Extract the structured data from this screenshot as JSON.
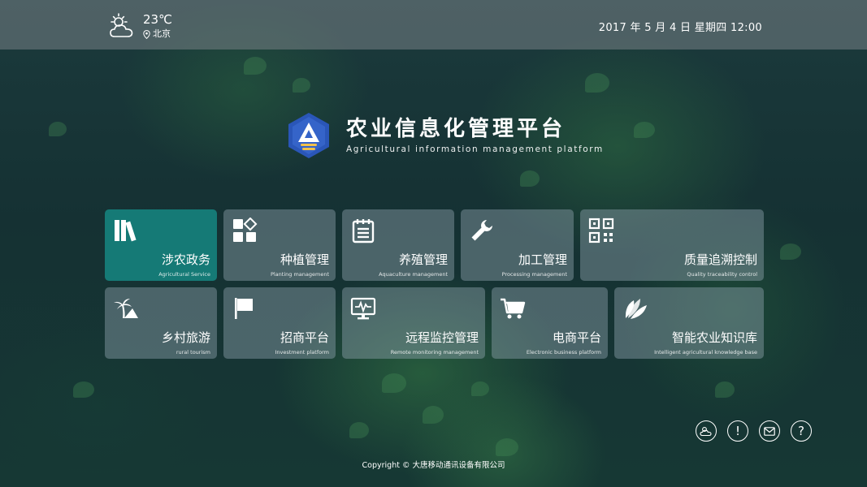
{
  "weather": {
    "temperature": "23℃",
    "city": "北京",
    "icon": "partly-cloudy-icon"
  },
  "datetime": "2017 年 5 月 4 日  星期四  12:00",
  "brand": {
    "title": "农业信息化管理平台",
    "subtitle": "Agricultural information management platform",
    "logo_icon": "platform-logo-icon"
  },
  "tiles": [
    {
      "label": "涉农政务",
      "sub": "Agricultural Service",
      "icon": "books-icon",
      "active": true
    },
    {
      "label": "种植管理",
      "sub": "Planting management",
      "icon": "grid-apps-icon"
    },
    {
      "label": "养殖管理",
      "sub": "Aquaculture management",
      "icon": "notepad-icon"
    },
    {
      "label": "加工管理",
      "sub": "Processing management",
      "icon": "wrench-icon"
    },
    {
      "label": "质量追溯控制",
      "sub": "Quality traceability control",
      "icon": "qr-code-icon"
    },
    {
      "label": "乡村旅游",
      "sub": "rural tourism",
      "icon": "palm-tree-icon"
    },
    {
      "label": "招商平台",
      "sub": "Investment platform",
      "icon": "flag-icon"
    },
    {
      "label": "远程监控管理",
      "sub": "Remote monitoring management",
      "icon": "monitor-icon"
    },
    {
      "label": "电商平台",
      "sub": "Electronic business platform",
      "icon": "shopping-cart-icon"
    },
    {
      "label": "智能农业知识库",
      "sub": "Intelligent agricultural knowledge base",
      "icon": "leaf-icon"
    }
  ],
  "tools": [
    {
      "icon": "weather-icon",
      "glyph": ""
    },
    {
      "icon": "alert-icon",
      "glyph": "!"
    },
    {
      "icon": "mail-icon",
      "glyph": ""
    },
    {
      "icon": "help-icon",
      "glyph": "?"
    }
  ],
  "footer": "Copyright © 大唐移动通讯设备有限公司",
  "colors": {
    "active_tile": "#16807c",
    "tile": "#96aab4",
    "background": "#153133"
  }
}
